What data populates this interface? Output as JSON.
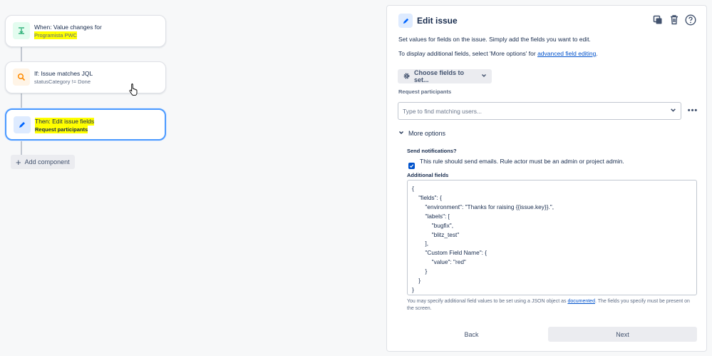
{
  "flow": {
    "trigger": {
      "title": "When: Value changes for",
      "subtitle": "Programista PWC",
      "icon": "field-change-icon",
      "color": "#36b37e"
    },
    "condition": {
      "title": "If: Issue matches JQL",
      "subtitle": "statusCategory != Done",
      "icon": "search-icon",
      "color": "#ff8b00"
    },
    "action": {
      "title": "Then: Edit issue fields",
      "subtitle": "Request participants",
      "icon": "pencil-icon",
      "color": "#0065ff"
    },
    "add_component": "Add component"
  },
  "panel": {
    "title": "Edit issue",
    "desc1": "Set values for fields on the issue. Simply add the fields you want to edit.",
    "desc2_prefix": "To display additional fields, select 'More options' for ",
    "desc2_link": "advanced field editing",
    "desc2_suffix": ".",
    "choose_fields": "Choose fields to set...",
    "request_participants_label": "Request participants",
    "user_placeholder": "Type to find matching users...",
    "more_options": "More options",
    "send_notifications_label": "Send notifications?",
    "send_notifications_text": "This rule should send emails. Rule actor must be an admin or project admin.",
    "send_notifications_checked": true,
    "additional_fields_label": "Additional fields",
    "additional_fields_json": "{\n    \"fields\": {\n        \"environment\": \"Thanks for raising {{issue.key}}.\",\n        \"labels\": [\n            \"bugfix\",\n            \"blitz_test\"\n        ],\n        \"Custom Field Name\": {\n            \"value\": \"red\"\n        }\n    }\n}",
    "help_prefix": "You may specify additional field values to be set using a JSON object as ",
    "help_link": "documented",
    "help_suffix": ". The fields you specify must be present on the screen.",
    "back": "Back",
    "next": "Next"
  },
  "colors": {
    "accent": "#0052cc",
    "highlight": "#ffff00",
    "selected_border": "#4c9aff"
  }
}
